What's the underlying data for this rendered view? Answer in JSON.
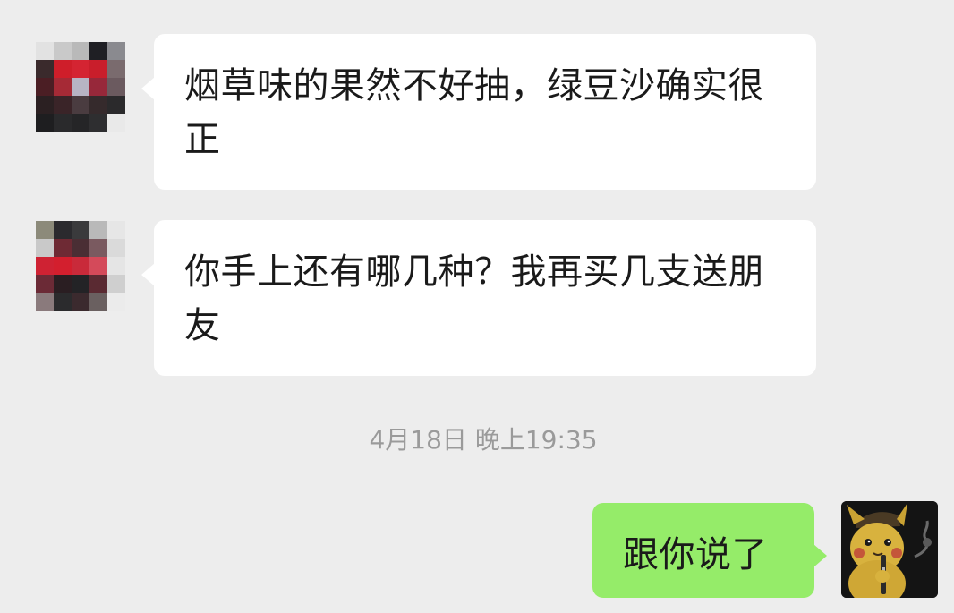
{
  "conversation": {
    "messages": [
      {
        "direction": "incoming",
        "sender_avatar": "pixelated-avatar-1",
        "text": "烟草味的果然不好抽，绿豆沙确实很正"
      },
      {
        "direction": "incoming",
        "sender_avatar": "pixelated-avatar-2",
        "text": "你手上还有哪几种？我再买几支送朋友"
      },
      {
        "direction": "outgoing",
        "sender_avatar": "pikachu-detective-avatar",
        "text": "跟你说了"
      }
    ],
    "timestamp": "4月18日 晚上19:35"
  },
  "colors": {
    "background": "#ededed",
    "incoming_bubble": "#ffffff",
    "outgoing_bubble": "#95ec69",
    "timestamp_text": "#9a9a9a"
  }
}
